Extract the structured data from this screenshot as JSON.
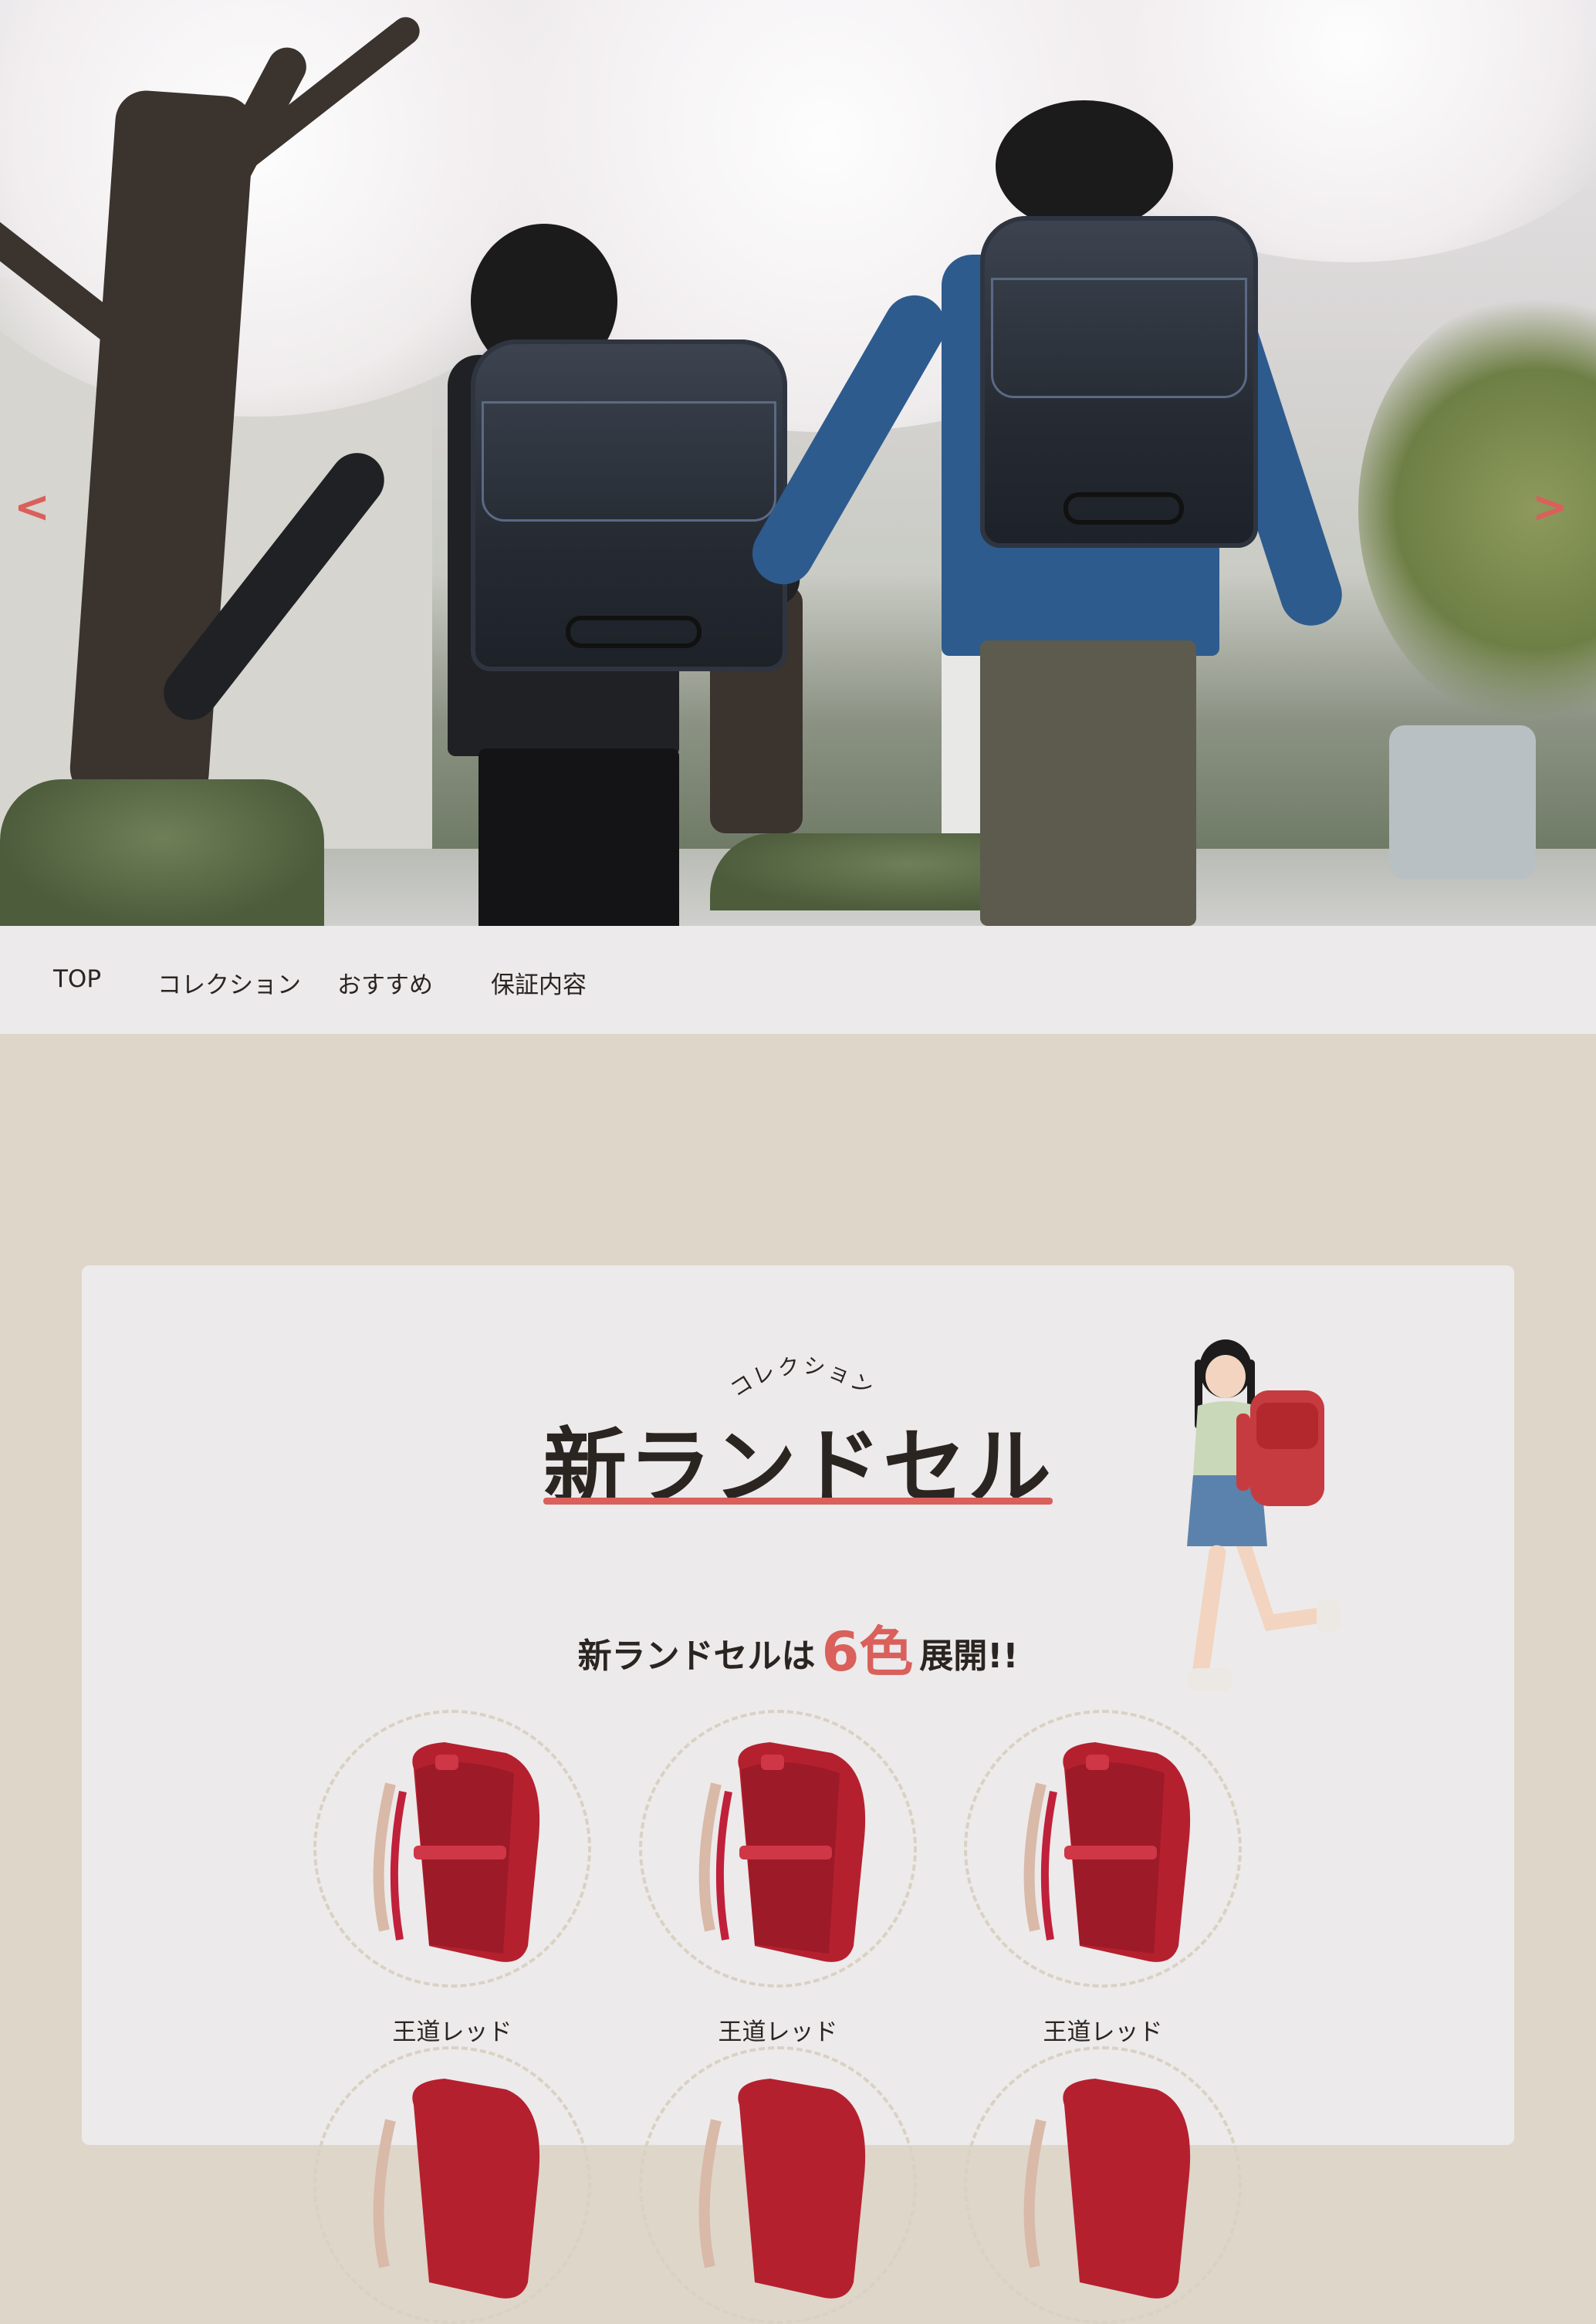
{
  "hero": {
    "prev_label": "<",
    "next_label": ">",
    "accent_color": "#d9605b"
  },
  "nav": {
    "items": [
      {
        "label": "TOP"
      },
      {
        "label": "コレクション"
      },
      {
        "label": "おすすめ"
      },
      {
        "label": "保証内容"
      }
    ]
  },
  "collection": {
    "subtitle": "コレクション",
    "title": "新ランドセル",
    "lead_prefix": "新ランドセルは",
    "lead_count": "6色",
    "lead_suffix": "展開!!",
    "products": [
      {
        "name": "王道レッド"
      },
      {
        "name": "王道レッド"
      },
      {
        "name": "王道レッド"
      },
      {
        "name": ""
      },
      {
        "name": ""
      },
      {
        "name": ""
      }
    ]
  }
}
